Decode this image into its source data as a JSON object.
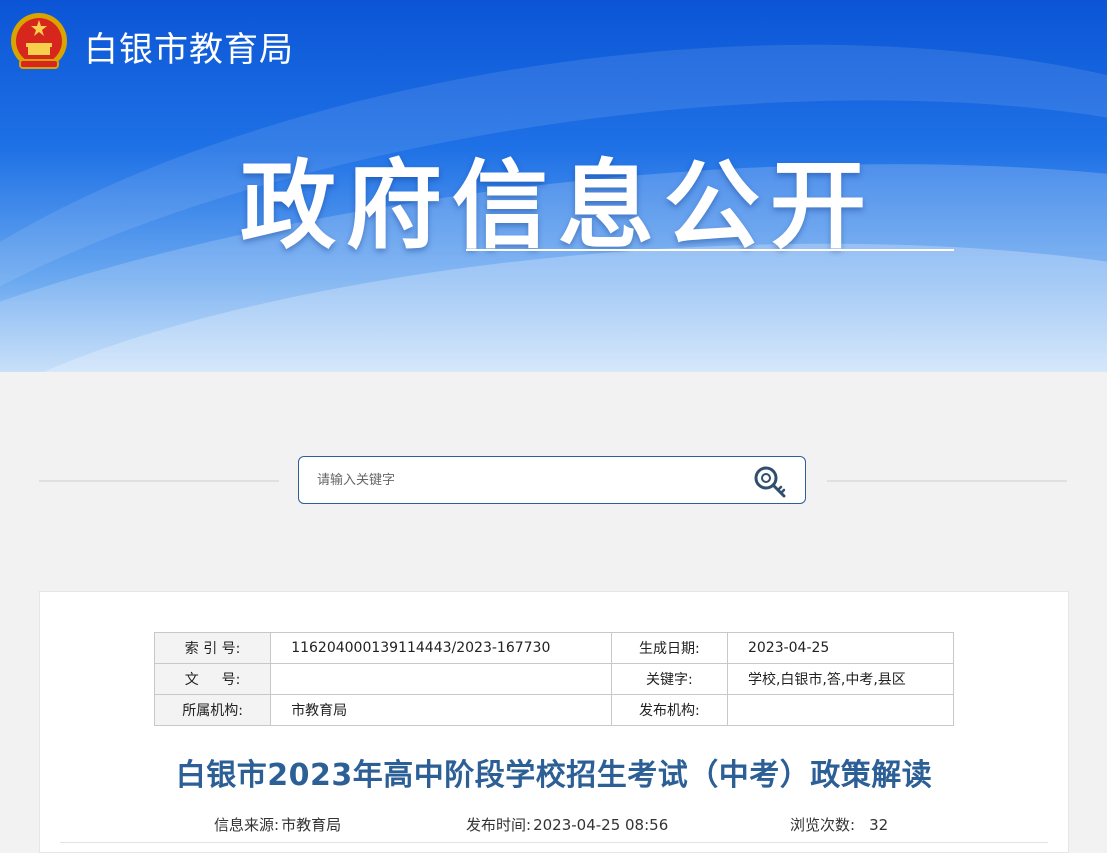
{
  "header": {
    "site_name": "白银市教育局",
    "banner_title": "政府信息公开",
    "emblem_icon": "national-emblem-icon"
  },
  "search": {
    "placeholder": "请输入关键字",
    "button_icon": "search-key-icon"
  },
  "meta": {
    "rows": [
      {
        "label1": "索 引 号:",
        "value1": "116204000139114443/2023-167730",
        "label2": "生成日期:",
        "value2": "2023-04-25"
      },
      {
        "label1": "文 　 号:",
        "value1": "",
        "label2": "关键字:",
        "value2": "学校,白银市,答,中考,县区"
      },
      {
        "label1": "所属机构:",
        "value1": "市教育局",
        "label2": "发布机构:",
        "value2": ""
      }
    ]
  },
  "article": {
    "title": "白银市2023年高中阶段学校招生考试（中考）政策解读",
    "source_label": "信息来源:",
    "source_value": "市教育局",
    "time_label": "发布时间:",
    "time_value": "2023-04-25 08:56",
    "views_label": "浏览次数:",
    "views_value": "32"
  },
  "colors": {
    "accent": "#2c5f95",
    "banner_blue": "#1f71e6"
  }
}
